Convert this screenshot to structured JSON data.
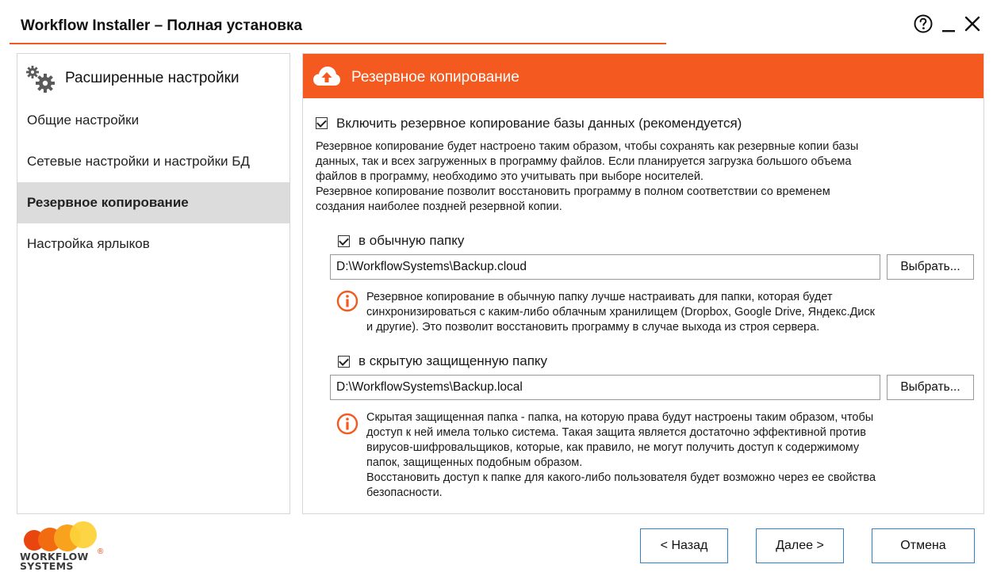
{
  "window": {
    "title": "Workflow Installer – Полная установка",
    "help_icon": "question-circle-icon",
    "minimize_icon": "minimize-icon",
    "close_icon": "close-icon",
    "accent_color": "#f45a1f"
  },
  "sidebar": {
    "header": "Расширенные настройки",
    "header_icon": "gears-icon",
    "items": [
      {
        "label": "Общие настройки",
        "active": false
      },
      {
        "label": "Сетевые настройки и настройки БД",
        "active": false
      },
      {
        "label": "Резервное копирование",
        "active": true
      },
      {
        "label": "Настройка ярлыков",
        "active": false
      }
    ]
  },
  "content": {
    "header": "Резервное копирование",
    "header_icon": "cloud-upload-icon",
    "enable_backup": {
      "label": "Включить резервное копирование базы данных (рекомендуется)",
      "checked": true
    },
    "description": [
      "Резервное копирование будет настроено таким образом, чтобы сохранять как резервные копии базы",
      "данных, так и всех загруженных в программу файлов. Если планируется загрузка большого объема",
      "файлов в программу, необходимо это учитывать при выборе носителей.",
      "Резервное копирование позволит восстановить программу в полном соответствии со временем",
      "создания наиболее поздней резервной копии."
    ],
    "regular_folder": {
      "label": "в обычную папку",
      "checked": true,
      "path": "D:\\WorkflowSystems\\Backup.cloud",
      "browse_label": "Выбрать...",
      "info": [
        "Резервное копирование в обычную папку лучше настраивать для папки, которая будет",
        "синхронизироваться с каким-либо облачным хранилищем (Dropbox, Google Drive, Яндекс.Диск",
        "и другие). Это позволит восстановить программу в случае выхода из строя сервера."
      ]
    },
    "hidden_folder": {
      "label": "в скрытую защищенную папку",
      "checked": true,
      "path": "D:\\WorkflowSystems\\Backup.local",
      "browse_label": "Выбрать...",
      "info": [
        "Скрытая защищенная папка - папка, на которую права будут настроены таким образом, чтобы",
        "доступ к ней имела только система. Такая защита является достаточно эффективной против",
        "вирусов-шифровальщиков, которые, как правило, не могут получить доступ к содержимому",
        "папок, защищенных подобным образом.",
        "Восстановить доступ к папке для какого-либо пользователя будет возможно через ее свойства",
        "безопасности."
      ]
    }
  },
  "logo": {
    "line1": "WORKFLOW",
    "line2": "SYSTEMS",
    "registered": "®"
  },
  "footer": {
    "back_label": "< Назад",
    "next_label": "Далее >",
    "cancel_label": "Отмена"
  }
}
